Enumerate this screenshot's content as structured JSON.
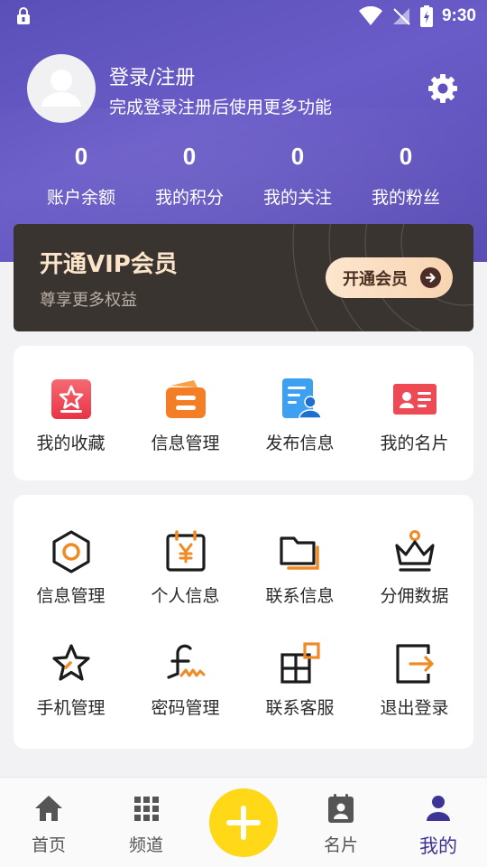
{
  "status_bar": {
    "time": "9:30"
  },
  "profile": {
    "title": "登录/注册",
    "subtitle": "完成登录注册后使用更多功能"
  },
  "stats": [
    {
      "value": "0",
      "label": "账户余额"
    },
    {
      "value": "0",
      "label": "我的积分"
    },
    {
      "value": "0",
      "label": "我的关注"
    },
    {
      "value": "0",
      "label": "我的粉丝"
    }
  ],
  "vip": {
    "title": "开通VIP会员",
    "subtitle": "尊享更多权益",
    "button": "开通会员"
  },
  "quick_actions": [
    {
      "label": "我的收藏",
      "icon": "favorites-icon"
    },
    {
      "label": "信息管理",
      "icon": "wallet-icon"
    },
    {
      "label": "发布信息",
      "icon": "publish-icon"
    },
    {
      "label": "我的名片",
      "icon": "business-card-icon"
    }
  ],
  "services": [
    {
      "label": "信息管理",
      "icon": "hexagon-icon"
    },
    {
      "label": "个人信息",
      "icon": "calendar-yen-icon"
    },
    {
      "label": "联系信息",
      "icon": "folder-icon"
    },
    {
      "label": "分佣数据",
      "icon": "crown-icon"
    },
    {
      "label": "手机管理",
      "icon": "star-icon"
    },
    {
      "label": "密码管理",
      "icon": "signature-icon"
    },
    {
      "label": "联系客服",
      "icon": "apps-icon"
    },
    {
      "label": "退出登录",
      "icon": "logout-icon"
    }
  ],
  "tabbar": {
    "items": [
      {
        "label": "首页",
        "icon": "home-icon"
      },
      {
        "label": "频道",
        "icon": "grid-icon"
      },
      {
        "label": "",
        "icon": "add-icon"
      },
      {
        "label": "名片",
        "icon": "contact-card-icon"
      },
      {
        "label": "我的",
        "icon": "person-icon"
      }
    ],
    "active_index": 4
  },
  "colors": {
    "header": "#5a4fb8",
    "accent_orange": "#f08a24",
    "active_tab": "#3d3596",
    "add_button": "#ffd817"
  }
}
